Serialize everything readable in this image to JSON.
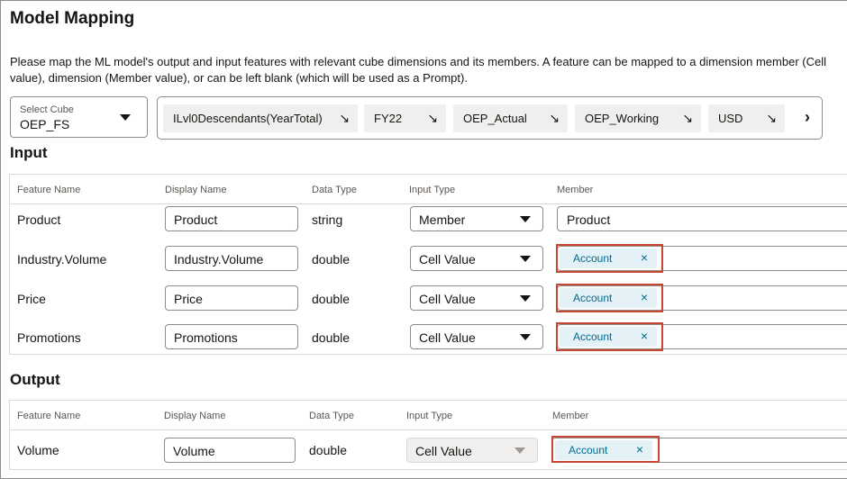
{
  "page": {
    "title": "Model Mapping",
    "description": "Please map the ML model's output and input features with relevant cube dimensions and its members. A feature can be mapped to a dimension member (Cell value), dimension (Member value), or can be left blank (which will be used as a Prompt)."
  },
  "cube": {
    "label": "Select Cube",
    "value": "OEP_FS"
  },
  "pov": [
    {
      "label": "ILvl0Descendants(YearTotal)"
    },
    {
      "label": "FY22"
    },
    {
      "label": "OEP_Actual"
    },
    {
      "label": "OEP_Working"
    },
    {
      "label": "USD"
    }
  ],
  "icons": {
    "pov_arrow": "↘",
    "next": "›",
    "remove": "×"
  },
  "input": {
    "heading": "Input",
    "columns": [
      "Feature Name",
      "Display Name",
      "Data Type",
      "Input Type",
      "Member"
    ],
    "rows": [
      {
        "feature": "Product",
        "display": "Product",
        "dtype": "string",
        "itype": "Member",
        "member": "Product"
      },
      {
        "feature": "Industry.Volume",
        "display": "Industry.Volume",
        "dtype": "double",
        "itype": "Cell Value",
        "member": "Account"
      },
      {
        "feature": "Price",
        "display": "Price",
        "dtype": "double",
        "itype": "Cell Value",
        "member": "Account"
      },
      {
        "feature": "Promotions",
        "display": "Promotions",
        "dtype": "double",
        "itype": "Cell Value",
        "member": "Account"
      }
    ]
  },
  "output": {
    "heading": "Output",
    "columns": [
      "Feature Name",
      "Display Name",
      "Data Type",
      "Input Type",
      "Member"
    ],
    "rows": [
      {
        "feature": "Volume",
        "display": "Volume",
        "dtype": "double",
        "itype": "Cell Value",
        "member": "Account"
      }
    ]
  },
  "colors": {
    "highlight": "#c74634",
    "chip_bg": "#e4f1f7",
    "chip_text": "#006b8f"
  }
}
